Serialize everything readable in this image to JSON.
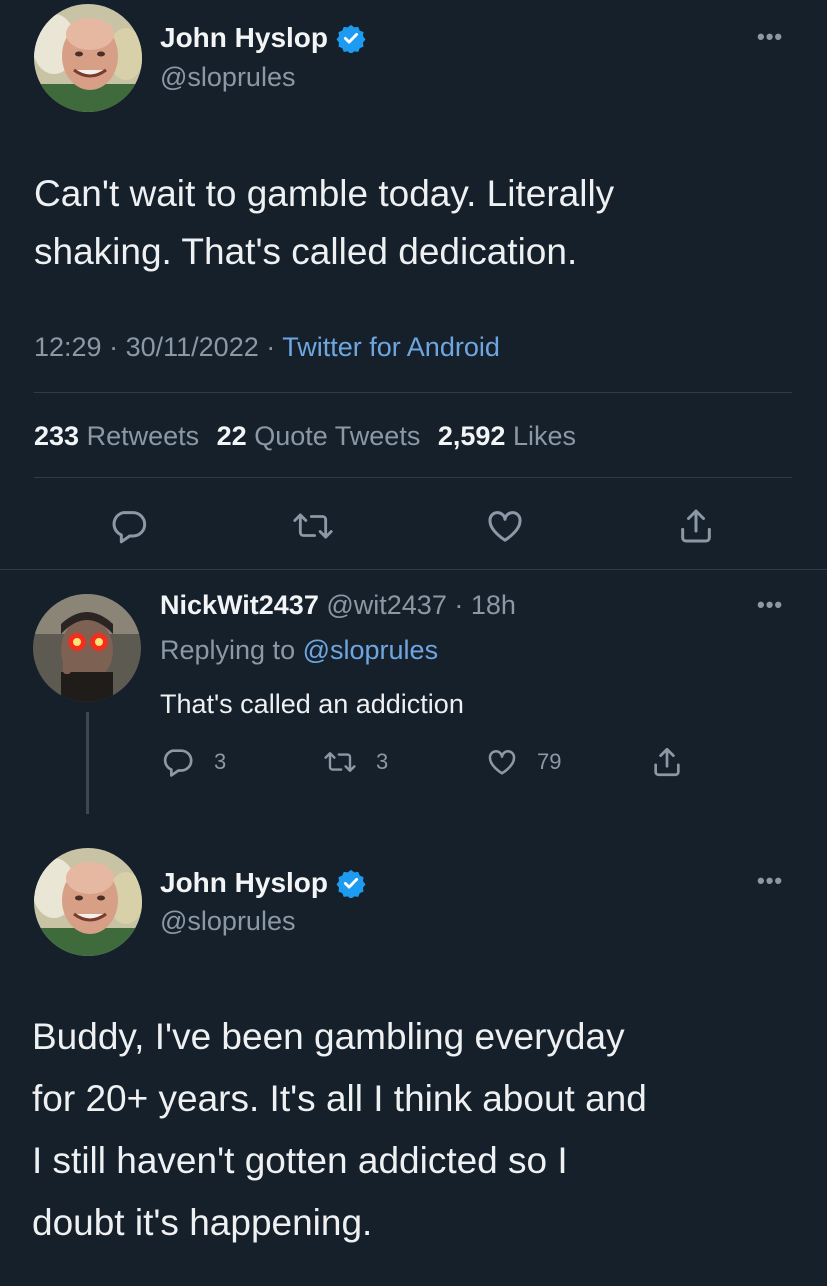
{
  "tweet1": {
    "name": "John Hyslop",
    "handle": "@sloprules",
    "text_line1": "Can't wait to gamble today. Literally",
    "text_line2": "shaking. That's called dedication.",
    "time": "12:29",
    "date": "30/11/2022",
    "source": "Twitter for Android",
    "sep": "·",
    "stats": {
      "retweets_count": "233",
      "retweets_label": "Retweets",
      "quotes_count": "22",
      "quotes_label": "Quote Tweets",
      "likes_count": "2,592",
      "likes_label": "Likes"
    }
  },
  "reply": {
    "name": "NickWit2437",
    "handle": "@wit2437",
    "age": "18h",
    "sep": "·",
    "replying_prefix": "Replying to",
    "replying_handle": "@sloprules",
    "text": "That's called an addiction",
    "replies": "3",
    "retweets": "3",
    "likes": "79"
  },
  "tweet2": {
    "name": "John Hyslop",
    "handle": "@sloprules",
    "lines": [
      "Buddy, I've been gambling everyday",
      "for 20+ years. It's all I think about and",
      "I still haven't gotten addicted so I",
      "doubt it's happening."
    ]
  },
  "colors": {
    "background": "#15202b",
    "verified": "#1d9bf0",
    "link": "#6fa6e0",
    "reply_eyes": "#ff2a1a"
  },
  "icons": [
    "verified-badge-icon",
    "more-icon",
    "reply-icon",
    "retweet-icon",
    "like-icon",
    "share-icon"
  ]
}
